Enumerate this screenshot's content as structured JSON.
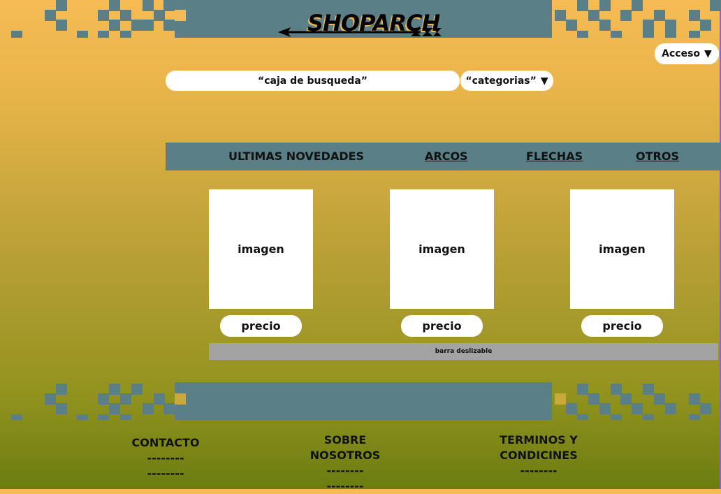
{
  "brand": {
    "logo_text": "SHOPARCH"
  },
  "header": {
    "access_label": "Acceso",
    "access_arrow": "▼"
  },
  "search": {
    "label": "“caja de busqueda”",
    "categories_label": "“categorias”",
    "categories_arrow": "▼"
  },
  "nav": {
    "items": [
      {
        "label": "ULTIMAS NOVEDADES"
      },
      {
        "label": "ARCOS"
      },
      {
        "label": "FLECHAS"
      },
      {
        "label": "OTROS"
      }
    ]
  },
  "products": [
    {
      "image_label": "imagen",
      "price_label": "precio"
    },
    {
      "image_label": "imagen",
      "price_label": "precio"
    },
    {
      "image_label": "imagen",
      "price_label": "precio"
    }
  ],
  "scrollbar": {
    "label": "barra deslizable"
  },
  "footer": {
    "contact": {
      "title": "CONTACTO",
      "line1": "--------",
      "line2": "--------"
    },
    "about": {
      "title": "SOBRE NOSOTROS",
      "line1": "--------",
      "line2": "--------"
    },
    "terms": {
      "title_line1": "TERMINOS Y",
      "title_line2": "CONDICINES",
      "line1": "--------"
    }
  },
  "colors": {
    "band": "#5a7f87",
    "bg_top": "#f6bb55",
    "bg_bottom": "#6b7d10",
    "scroll": "#a3a3a3"
  },
  "icons": {
    "logo_arrow": "arrow-icon",
    "dropdown": "caret-down-icon"
  }
}
